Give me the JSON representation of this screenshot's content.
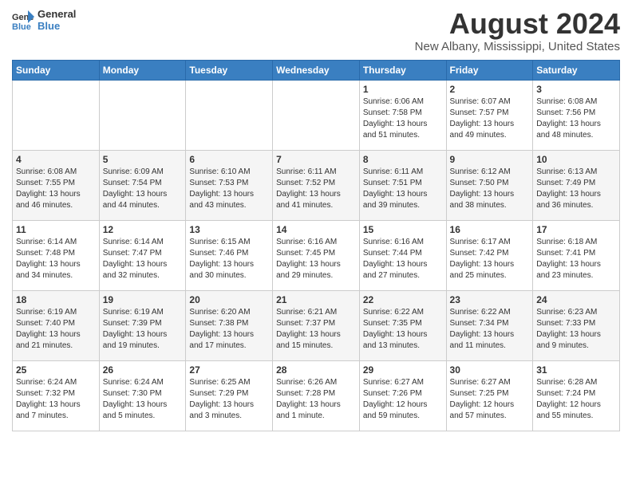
{
  "logo": {
    "line1": "General",
    "line2": "Blue"
  },
  "title": "August 2024",
  "location": "New Albany, Mississippi, United States",
  "weekdays": [
    "Sunday",
    "Monday",
    "Tuesday",
    "Wednesday",
    "Thursday",
    "Friday",
    "Saturday"
  ],
  "weeks": [
    [
      {
        "day": "",
        "info": ""
      },
      {
        "day": "",
        "info": ""
      },
      {
        "day": "",
        "info": ""
      },
      {
        "day": "",
        "info": ""
      },
      {
        "day": "1",
        "info": "Sunrise: 6:06 AM\nSunset: 7:58 PM\nDaylight: 13 hours\nand 51 minutes."
      },
      {
        "day": "2",
        "info": "Sunrise: 6:07 AM\nSunset: 7:57 PM\nDaylight: 13 hours\nand 49 minutes."
      },
      {
        "day": "3",
        "info": "Sunrise: 6:08 AM\nSunset: 7:56 PM\nDaylight: 13 hours\nand 48 minutes."
      }
    ],
    [
      {
        "day": "4",
        "info": "Sunrise: 6:08 AM\nSunset: 7:55 PM\nDaylight: 13 hours\nand 46 minutes."
      },
      {
        "day": "5",
        "info": "Sunrise: 6:09 AM\nSunset: 7:54 PM\nDaylight: 13 hours\nand 44 minutes."
      },
      {
        "day": "6",
        "info": "Sunrise: 6:10 AM\nSunset: 7:53 PM\nDaylight: 13 hours\nand 43 minutes."
      },
      {
        "day": "7",
        "info": "Sunrise: 6:11 AM\nSunset: 7:52 PM\nDaylight: 13 hours\nand 41 minutes."
      },
      {
        "day": "8",
        "info": "Sunrise: 6:11 AM\nSunset: 7:51 PM\nDaylight: 13 hours\nand 39 minutes."
      },
      {
        "day": "9",
        "info": "Sunrise: 6:12 AM\nSunset: 7:50 PM\nDaylight: 13 hours\nand 38 minutes."
      },
      {
        "day": "10",
        "info": "Sunrise: 6:13 AM\nSunset: 7:49 PM\nDaylight: 13 hours\nand 36 minutes."
      }
    ],
    [
      {
        "day": "11",
        "info": "Sunrise: 6:14 AM\nSunset: 7:48 PM\nDaylight: 13 hours\nand 34 minutes."
      },
      {
        "day": "12",
        "info": "Sunrise: 6:14 AM\nSunset: 7:47 PM\nDaylight: 13 hours\nand 32 minutes."
      },
      {
        "day": "13",
        "info": "Sunrise: 6:15 AM\nSunset: 7:46 PM\nDaylight: 13 hours\nand 30 minutes."
      },
      {
        "day": "14",
        "info": "Sunrise: 6:16 AM\nSunset: 7:45 PM\nDaylight: 13 hours\nand 29 minutes."
      },
      {
        "day": "15",
        "info": "Sunrise: 6:16 AM\nSunset: 7:44 PM\nDaylight: 13 hours\nand 27 minutes."
      },
      {
        "day": "16",
        "info": "Sunrise: 6:17 AM\nSunset: 7:42 PM\nDaylight: 13 hours\nand 25 minutes."
      },
      {
        "day": "17",
        "info": "Sunrise: 6:18 AM\nSunset: 7:41 PM\nDaylight: 13 hours\nand 23 minutes."
      }
    ],
    [
      {
        "day": "18",
        "info": "Sunrise: 6:19 AM\nSunset: 7:40 PM\nDaylight: 13 hours\nand 21 minutes."
      },
      {
        "day": "19",
        "info": "Sunrise: 6:19 AM\nSunset: 7:39 PM\nDaylight: 13 hours\nand 19 minutes."
      },
      {
        "day": "20",
        "info": "Sunrise: 6:20 AM\nSunset: 7:38 PM\nDaylight: 13 hours\nand 17 minutes."
      },
      {
        "day": "21",
        "info": "Sunrise: 6:21 AM\nSunset: 7:37 PM\nDaylight: 13 hours\nand 15 minutes."
      },
      {
        "day": "22",
        "info": "Sunrise: 6:22 AM\nSunset: 7:35 PM\nDaylight: 13 hours\nand 13 minutes."
      },
      {
        "day": "23",
        "info": "Sunrise: 6:22 AM\nSunset: 7:34 PM\nDaylight: 13 hours\nand 11 minutes."
      },
      {
        "day": "24",
        "info": "Sunrise: 6:23 AM\nSunset: 7:33 PM\nDaylight: 13 hours\nand 9 minutes."
      }
    ],
    [
      {
        "day": "25",
        "info": "Sunrise: 6:24 AM\nSunset: 7:32 PM\nDaylight: 13 hours\nand 7 minutes."
      },
      {
        "day": "26",
        "info": "Sunrise: 6:24 AM\nSunset: 7:30 PM\nDaylight: 13 hours\nand 5 minutes."
      },
      {
        "day": "27",
        "info": "Sunrise: 6:25 AM\nSunset: 7:29 PM\nDaylight: 13 hours\nand 3 minutes."
      },
      {
        "day": "28",
        "info": "Sunrise: 6:26 AM\nSunset: 7:28 PM\nDaylight: 13 hours\nand 1 minute."
      },
      {
        "day": "29",
        "info": "Sunrise: 6:27 AM\nSunset: 7:26 PM\nDaylight: 12 hours\nand 59 minutes."
      },
      {
        "day": "30",
        "info": "Sunrise: 6:27 AM\nSunset: 7:25 PM\nDaylight: 12 hours\nand 57 minutes."
      },
      {
        "day": "31",
        "info": "Sunrise: 6:28 AM\nSunset: 7:24 PM\nDaylight: 12 hours\nand 55 minutes."
      }
    ]
  ]
}
